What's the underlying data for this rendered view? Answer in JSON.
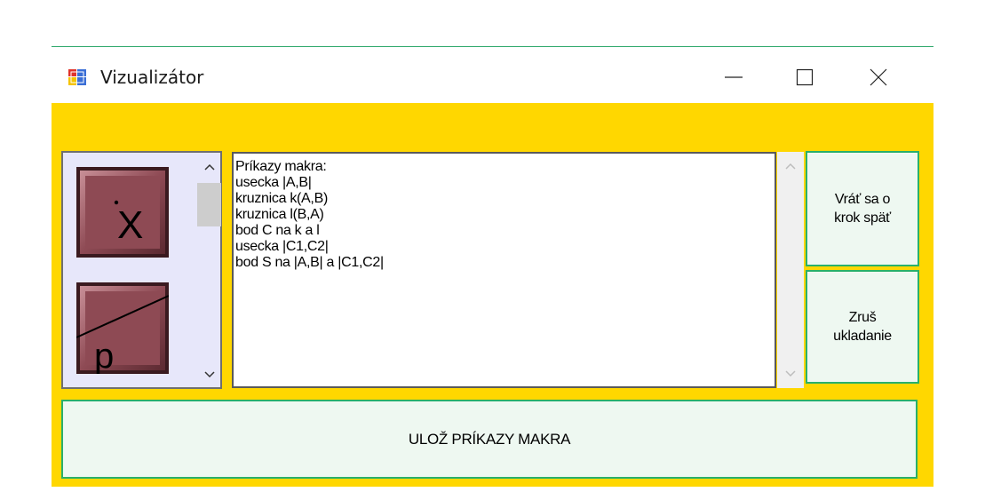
{
  "window": {
    "title": "Vizualizátor",
    "icon": "app-window-icon",
    "controls": [
      "minimize-icon",
      "maximize-icon",
      "close-icon"
    ]
  },
  "colors": {
    "client_background": "#ffd700",
    "tool_panel_background": "#e7e7fa",
    "button_background": "#eef8f1",
    "button_border": "#29b06a",
    "tool_button_fill": "#8e4a54"
  },
  "tools": [
    {
      "name": "point-on-intersection-tool",
      "glyph": "X"
    },
    {
      "name": "line-with-point-tool",
      "glyph": "p"
    }
  ],
  "macro_text": {
    "lines": [
      "Príkazy makra:",
      "usecka |A,B|",
      "kruznica k(A,B)",
      "kruznica l(B,A)",
      "bod C na k a l",
      "usecka |C1,C2|",
      "bod S na |A,B| a |C1,C2|"
    ]
  },
  "buttons": {
    "undo_line1": "Vráť sa o",
    "undo_line2": "krok späť",
    "cancel_line1": "Zruš",
    "cancel_line2": "ukladanie",
    "save": "ULOŽ PRÍKAZY MAKRA"
  }
}
